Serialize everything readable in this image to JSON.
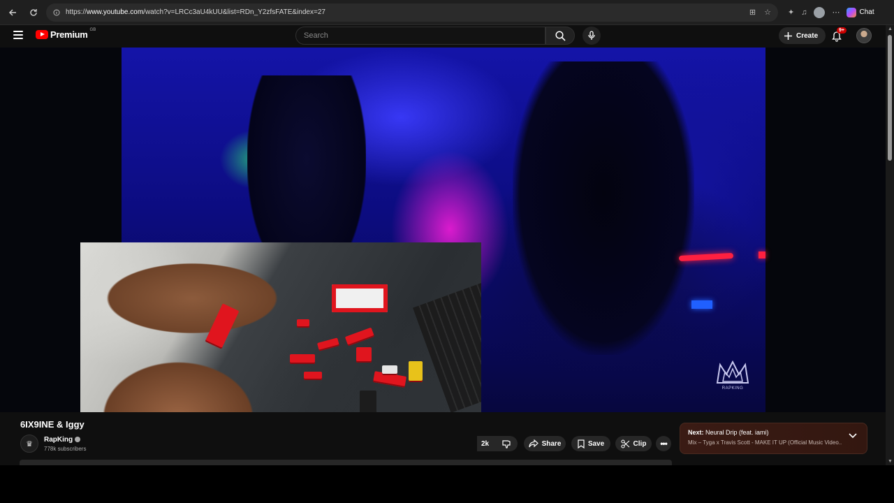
{
  "browser": {
    "url_prefix": "https://",
    "url_host": "www.youtube.com",
    "url_path": "/watch?v=LRCc3aU4kUU&list=RDn_Y2zfsFATE&index=27",
    "copilot_label": "Chat"
  },
  "header": {
    "logo_text": "Premium",
    "logo_region": "GB",
    "search_placeholder": "Search",
    "create_label": "Create",
    "notification_badge": "9+"
  },
  "video": {
    "watermark_text": "RAPKING"
  },
  "info": {
    "title": "6IX9INE & Iggy",
    "channel_name": "RapKing",
    "channel_subs": "778k subscribers",
    "like_count": "2k",
    "share_label": "Share",
    "save_label": "Save",
    "clip_label": "Clip"
  },
  "next": {
    "prefix": "Next:",
    "title": "Neural Drip (feat. iami)",
    "subtitle": "Mix – Tyga x Travis Scott - MAKE IT UP (Official Music Video..."
  },
  "colors": {
    "brand_red": "#ff0000",
    "badge_red": "#cc0000",
    "background": "#0f0f0f"
  }
}
